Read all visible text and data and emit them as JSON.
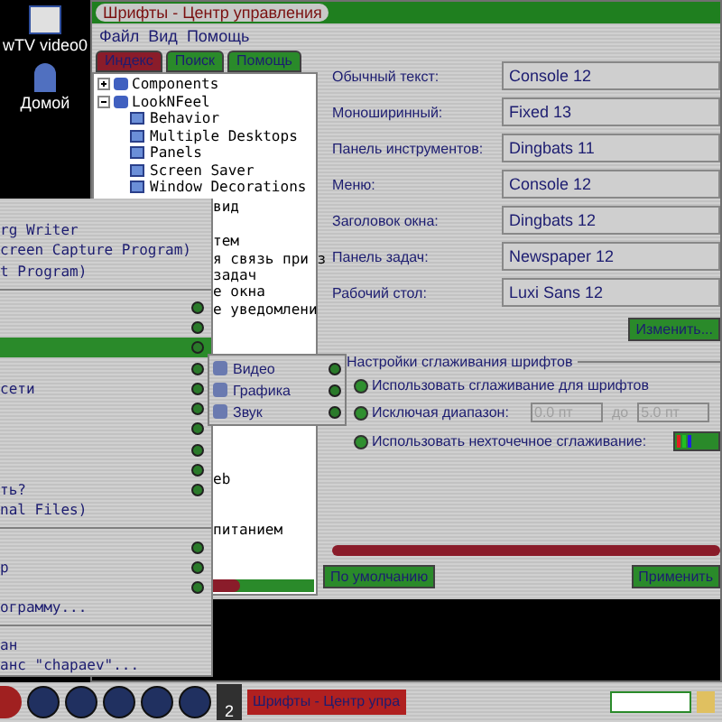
{
  "desktop_icons": [
    {
      "label": "wTV video0"
    },
    {
      "label": "Домой"
    }
  ],
  "window": {
    "title": "Шрифты - Центр управления",
    "menu": [
      "Файл",
      "Вид",
      "Помощь"
    ],
    "tabs": [
      {
        "label": "Индекс",
        "selected": true
      },
      {
        "label": "Поиск",
        "selected": false
      },
      {
        "label": "Помощь",
        "selected": false
      }
    ],
    "tree": [
      {
        "label": "Components",
        "expanded": false
      },
      {
        "label": "LookNFeel",
        "expanded": true,
        "children": [
          {
            "label": "Behavior"
          },
          {
            "label": "Multiple Desktops"
          },
          {
            "label": "Panels"
          },
          {
            "label": "Screen Saver"
          },
          {
            "label": "Window Decorations"
          }
        ]
      }
    ],
    "tree_partly_hidden": [
      "вид",
      "тем",
      "я связь при з",
      "задач",
      "е окна",
      "е уведомлени",
      "eb",
      "питанием"
    ],
    "fonts": [
      {
        "label": "Обычный текст:",
        "value": "Console 12"
      },
      {
        "label": "Моноширинный:",
        "value": "Fixed 13"
      },
      {
        "label": "Панель инструментов:",
        "value": "Dingbats 11"
      },
      {
        "label": "Меню:",
        "value": "Console 12"
      },
      {
        "label": "Заголовок окна:",
        "value": "Dingbats 12"
      },
      {
        "label": "Панель задач:",
        "value": "Newspaper 12"
      },
      {
        "label": "Рабочий стол:",
        "value": "Luxi Sans 12"
      }
    ],
    "change_button": "Изменить...",
    "antialias": {
      "title": "Настройки сглаживания шрифтов",
      "use": {
        "label": "Использовать сглаживание для шрифтов",
        "checked": true
      },
      "exclude": {
        "label": "Исключая диапазон:",
        "checked": true,
        "from": "0.0 пт",
        "to_label": "до",
        "to": "5.0 пт",
        "disabled": true
      },
      "subpixel": {
        "label": "Использовать нехточечное сглаживание:",
        "checked": true
      }
    },
    "buttons": [
      "По умолчанию",
      "Применить"
    ]
  },
  "kmenu": {
    "items": [
      {
        "kind": "item",
        "text": "rg Writer"
      },
      {
        "kind": "item",
        "text": "creen Capture Program)"
      },
      {
        "kind": "item",
        "text": "t Program)"
      },
      {
        "kind": "separator"
      },
      {
        "kind": "submenu",
        "selected": false
      },
      {
        "kind": "submenu",
        "selected": false
      },
      {
        "kind": "submenu",
        "selected": true
      },
      {
        "kind": "submenu",
        "selected": false
      },
      {
        "kind": "submenu",
        "text": "сети",
        "selected": false
      },
      {
        "kind": "submenu",
        "selected": false
      },
      {
        "kind": "submenu",
        "selected": false
      },
      {
        "kind": "submenu",
        "selected": false
      },
      {
        "kind": "submenu",
        "selected": false
      },
      {
        "kind": "submenu",
        "text": "ть?",
        "selected": false
      },
      {
        "kind": "item",
        "text": "nal Files)"
      },
      {
        "kind": "separator"
      },
      {
        "kind": "submenu",
        "selected": false
      },
      {
        "kind": "submenu",
        "text": "р",
        "selected": false
      },
      {
        "kind": "submenu",
        "selected": false
      },
      {
        "kind": "item",
        "text": "ограмму..."
      },
      {
        "kind": "separator"
      },
      {
        "kind": "item",
        "text": "ан"
      },
      {
        "kind": "item",
        "text": "анс \"chapaev\"..."
      }
    ],
    "submenu": [
      "Видео",
      "Графика",
      "Звук"
    ]
  },
  "taskbar": {
    "pager": "2",
    "task": "Шрифты - Центр упра"
  }
}
